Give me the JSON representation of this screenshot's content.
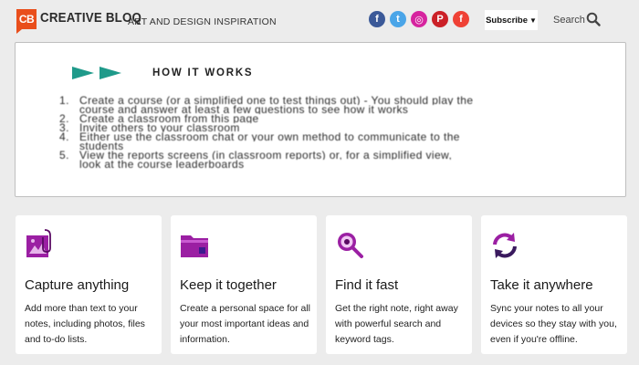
{
  "header": {
    "logo_mark": "CB",
    "logo_text": "CREATIVE BLOQ",
    "tagline": "ART AND DESIGN INSPIRATION",
    "social": [
      {
        "name": "facebook-icon",
        "glyph": "f",
        "color": "#3b5998"
      },
      {
        "name": "twitter-icon",
        "glyph": "t",
        "color": "#4aa5e8"
      },
      {
        "name": "instagram-icon",
        "glyph": "◎",
        "color": "#d6249f"
      },
      {
        "name": "pinterest-icon",
        "glyph": "P",
        "color": "#cb2027"
      },
      {
        "name": "flipboard-icon",
        "glyph": "f",
        "color": "#ef4135"
      }
    ],
    "subscribe_label": "Subscribe",
    "subscribe_caret": "▼",
    "search_label": "Search"
  },
  "panel": {
    "title": "HOW IT WORKS",
    "steps": [
      {
        "num": "1.",
        "line1": "Create a course (or a simplified one to test things out) - You should play the",
        "line2": "course and answer at least a few questions to see how it works"
      },
      {
        "num": "2.",
        "line1": "Create a classroom from this page"
      },
      {
        "num": "3.",
        "line1": "Invite others to your classroom"
      },
      {
        "num": "4.",
        "line1": "Either use the classroom chat or your own method to communicate to the",
        "line2": "students"
      },
      {
        "num": "5.",
        "line1": "View the reports screens (in classroom reports) or, for a simplified view,",
        "line2": "look at the course leaderboards"
      }
    ]
  },
  "cards": [
    {
      "icon": "image-clip-icon",
      "title": "Capture anything",
      "desc": "Add more than text to your notes, including photos, files and to-do lists."
    },
    {
      "icon": "folder-icon",
      "title": "Keep it together",
      "desc": "Create a personal space for all your most important ideas and information."
    },
    {
      "icon": "search-magnifier-icon",
      "title": "Find it fast",
      "desc": "Get the right note, right away with powerful search and keyword tags."
    },
    {
      "icon": "sync-icon",
      "title": "Take it anywhere",
      "desc": "Sync your notes to all your devices so they stay with you, even if you're offline."
    }
  ],
  "colors": {
    "brand": "#e94e1b",
    "accent": "#9b1fa3",
    "panel_arrow": "#1f9a8a"
  }
}
